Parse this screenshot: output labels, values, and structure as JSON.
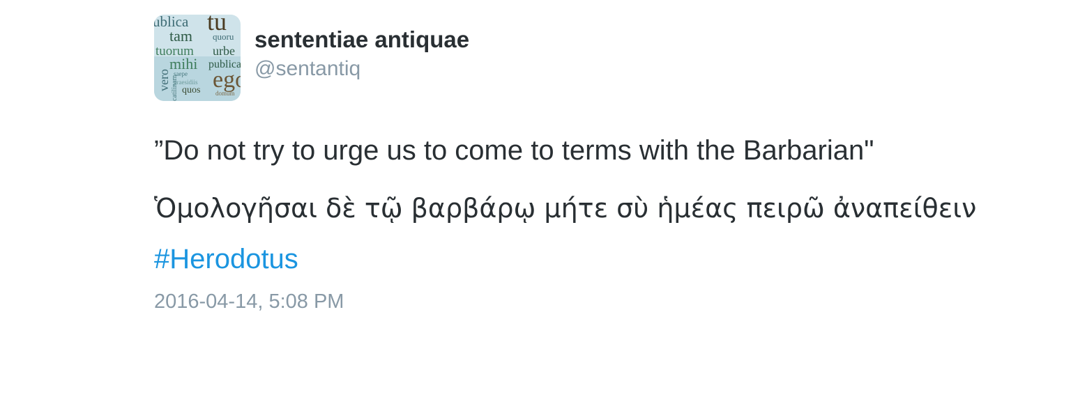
{
  "tweet": {
    "author": {
      "display_name": "sententiae antiquae",
      "handle": "@sentantiq",
      "avatar_words": [
        "ublica",
        "tu",
        "tam",
        "quoru",
        "tuorum",
        "urbe",
        "mihi",
        "publica",
        "ego",
        "vero",
        "saepe",
        "praesidiis",
        "catilinam",
        "quos",
        "domum"
      ]
    },
    "text_line_en": "”Do not try to urge us to come to terms with the Barbarian\"",
    "text_line_gr": "Ὁμολογῆσαι δὲ τῷ βαρβάρῳ μήτε  σὺ ἡμέας πειρῶ ἀναπείθειν",
    "hashtag": "#Herodotus",
    "timestamp": "2016-04-14, 5:08 PM",
    "colors": {
      "hashtag": "#1b95e0",
      "muted": "#8899a6",
      "text": "#292f33"
    }
  }
}
